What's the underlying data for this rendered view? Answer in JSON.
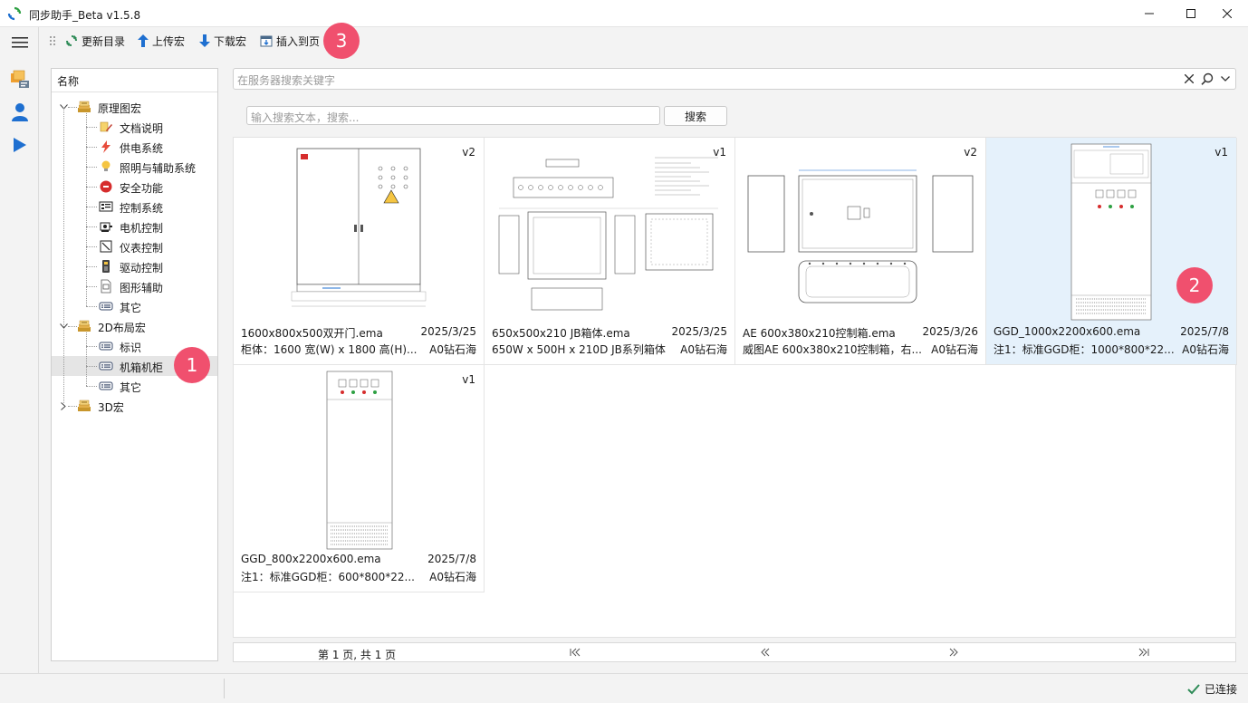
{
  "window": {
    "title": "同步助手_Beta v1.5.8",
    "app_icon": "sync-icon",
    "controls": [
      "minimize-icon",
      "maximize-icon",
      "close-icon"
    ]
  },
  "sidebar": {
    "buttons": [
      {
        "icon": "menu-icon"
      },
      {
        "icon": "macro-library-icon"
      },
      {
        "icon": "user-icon"
      },
      {
        "icon": "play-icon"
      }
    ]
  },
  "toolbar": {
    "refresh_label": "更新目录",
    "upload_label": "上传宏",
    "download_label": "下载宏",
    "insert_label": "插入到页"
  },
  "tree": {
    "header": "名称",
    "nodes": [
      {
        "label": "原理图宏",
        "level": 0,
        "expanded": true,
        "icon": "folder-stack-icon"
      },
      {
        "label": "文档说明",
        "level": 1,
        "icon": "document-pen-icon"
      },
      {
        "label": "供电系统",
        "level": 1,
        "icon": "lightning-icon"
      },
      {
        "label": "照明与辅助系统",
        "level": 1,
        "icon": "bulb-icon"
      },
      {
        "label": "安全功能",
        "level": 1,
        "icon": "safety-icon"
      },
      {
        "label": "控制系统",
        "level": 1,
        "icon": "control-panel-icon"
      },
      {
        "label": "电机控制",
        "level": 1,
        "icon": "motor-icon"
      },
      {
        "label": "仪表控制",
        "level": 1,
        "icon": "gauge-icon"
      },
      {
        "label": "驱动控制",
        "level": 1,
        "icon": "drive-icon"
      },
      {
        "label": "图形辅助",
        "level": 1,
        "icon": "graphic-icon"
      },
      {
        "label": "其它",
        "level": 1,
        "icon": "tag-icon"
      },
      {
        "label": "2D布局宏",
        "level": 0,
        "expanded": true,
        "icon": "folder-stack-icon"
      },
      {
        "label": "标识",
        "level": 1,
        "icon": "tag-icon"
      },
      {
        "label": "机箱机柜",
        "level": 1,
        "icon": "tag-icon",
        "selected": true
      },
      {
        "label": "其它",
        "level": 1,
        "icon": "tag-icon"
      },
      {
        "label": "3D宏",
        "level": 0,
        "expanded": false,
        "icon": "folder-stack-icon"
      }
    ]
  },
  "server_search": {
    "placeholder": "在服务器搜索关键字"
  },
  "text_search": {
    "placeholder": "输入搜索文本，搜索...",
    "button_label": "搜索"
  },
  "cards": [
    {
      "version": "v2",
      "name": "1600x800x500双开门.ema",
      "date": "2025/3/25",
      "desc": "柜体：1600 宽(W) x 1800 高(H)...",
      "author": "A0钻石海",
      "thumb": "double-door-cabinet"
    },
    {
      "version": "v1",
      "name": "650x500x210 JB箱体.ema",
      "date": "2025/3/25",
      "desc": "650W x 500H x 210D JB系列箱体",
      "author": "A0钻石海",
      "thumb": "jb-box-drawing"
    },
    {
      "version": "v2",
      "name": "AE 600x380x210控制箱.ema",
      "date": "2025/3/26",
      "desc": "威图AE 600x380x210控制箱，右...",
      "author": "A0钻石海",
      "thumb": "ae-control-box"
    },
    {
      "version": "v1",
      "name": "GGD_1000x2200x600.ema",
      "date": "2025/7/8",
      "desc": "注1：标准GGD柜：1000*800*22...",
      "author": "A0钻石海",
      "thumb": "ggd-cabinet-wide",
      "selected": true
    },
    {
      "version": "v1",
      "name": "GGD_800x2200x600.ema",
      "date": "2025/7/8",
      "desc": "注1：标准GGD柜：600*800*22...",
      "author": "A0钻石海",
      "thumb": "ggd-cabinet-narrow"
    }
  ],
  "pagination": {
    "text": "第 1 页, 共 1 页",
    "first": "|◀",
    "prev": "«",
    "next": "»",
    "last": "▶|"
  },
  "status": {
    "text": "已连接",
    "color": "#2e8b57"
  },
  "annotations": [
    "1",
    "2",
    "3"
  ],
  "colors": {
    "accent": "#1e6fd0",
    "selection": "#e5f1fb",
    "badge": "#f0506e"
  }
}
